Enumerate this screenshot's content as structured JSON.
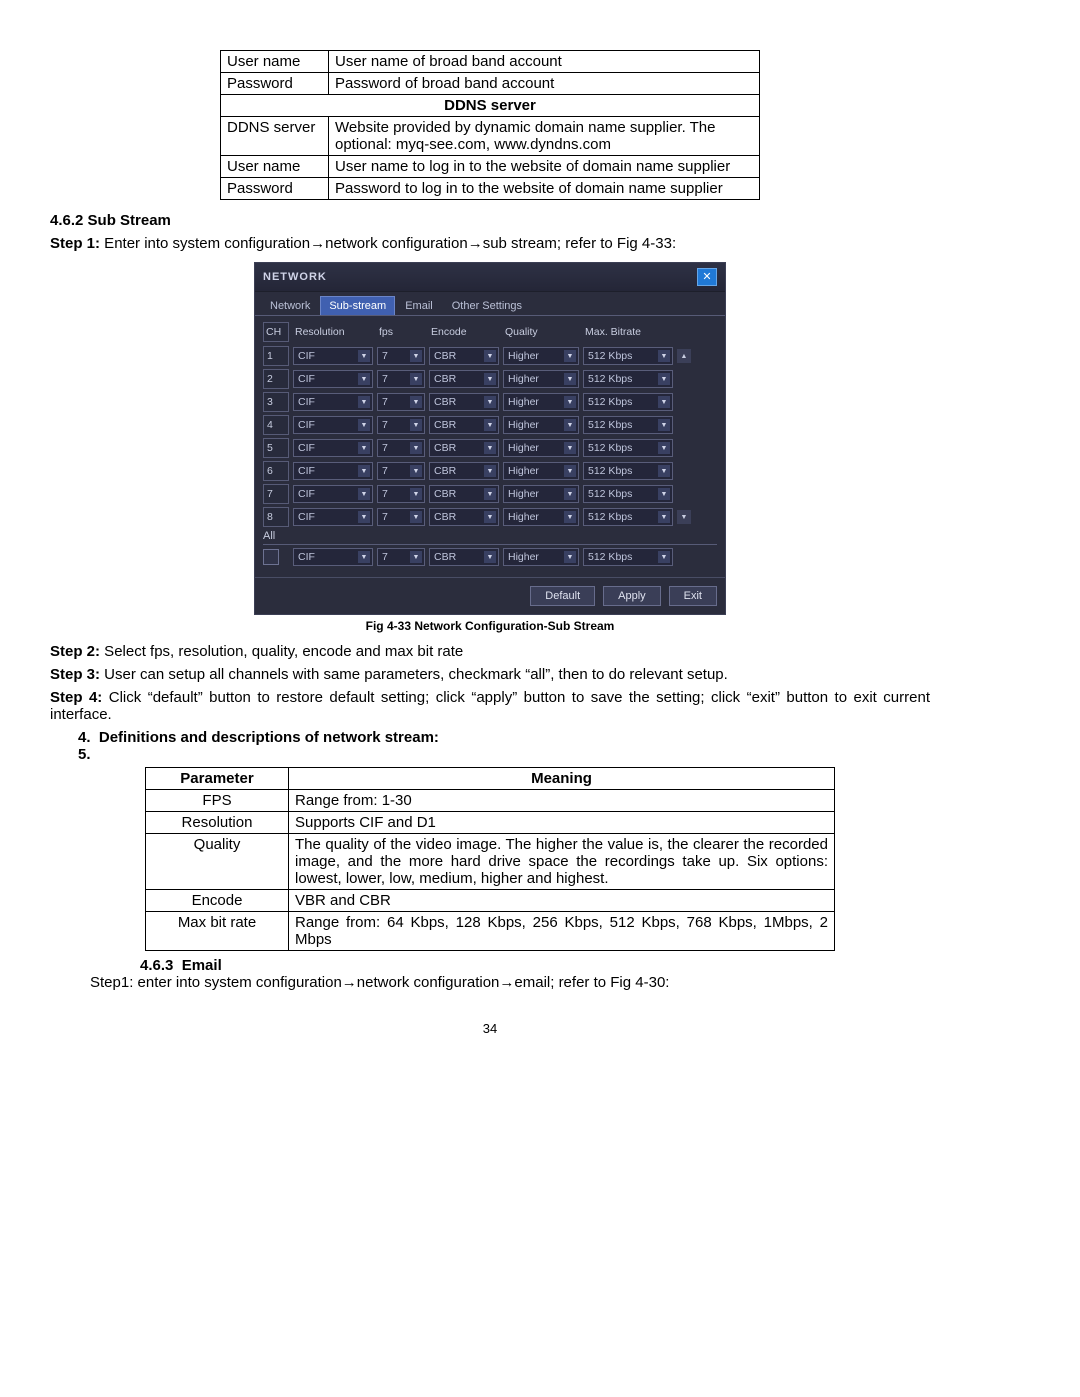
{
  "table1": {
    "r1c1": "User name",
    "r1c2": "User name of broad band account",
    "r2c1": "Password",
    "r2c2": "Password of broad band account",
    "section": "DDNS server",
    "r3c1": "DDNS server",
    "r3c2": "Website provided by dynamic domain name supplier. The optional: myq-see.com, www.dyndns.com",
    "r4c1": "User name",
    "r4c2": "User name to log in to the website of domain name supplier",
    "r5c1": "Password",
    "r5c2": "Password to log in to the website of domain name supplier"
  },
  "section_462": "4.6.2 Sub Stream",
  "step1_lead": "Step 1:",
  "step1_text": " Enter into system configuration→network configuration→sub stream; refer to Fig 4-33:",
  "ui": {
    "title": "NETWORK",
    "tabs": [
      "Network",
      "Sub-stream",
      "Email",
      "Other Settings"
    ],
    "headers": [
      "CH",
      "Resolution",
      "fps",
      "Encode",
      "Quality",
      "Max. Bitrate"
    ],
    "rows": [
      {
        "ch": "1",
        "res": "CIF",
        "fps": "7",
        "enc": "CBR",
        "q": "Higher",
        "br": "512 Kbps"
      },
      {
        "ch": "2",
        "res": "CIF",
        "fps": "7",
        "enc": "CBR",
        "q": "Higher",
        "br": "512 Kbps"
      },
      {
        "ch": "3",
        "res": "CIF",
        "fps": "7",
        "enc": "CBR",
        "q": "Higher",
        "br": "512 Kbps"
      },
      {
        "ch": "4",
        "res": "CIF",
        "fps": "7",
        "enc": "CBR",
        "q": "Higher",
        "br": "512 Kbps"
      },
      {
        "ch": "5",
        "res": "CIF",
        "fps": "7",
        "enc": "CBR",
        "q": "Higher",
        "br": "512 Kbps"
      },
      {
        "ch": "6",
        "res": "CIF",
        "fps": "7",
        "enc": "CBR",
        "q": "Higher",
        "br": "512 Kbps"
      },
      {
        "ch": "7",
        "res": "CIF",
        "fps": "7",
        "enc": "CBR",
        "q": "Higher",
        "br": "512 Kbps"
      },
      {
        "ch": "8",
        "res": "CIF",
        "fps": "7",
        "enc": "CBR",
        "q": "Higher",
        "br": "512 Kbps"
      }
    ],
    "all_label": "All",
    "all": {
      "res": "CIF",
      "fps": "7",
      "enc": "CBR",
      "q": "Higher",
      "br": "512 Kbps"
    },
    "buttons": {
      "default": "Default",
      "apply": "Apply",
      "exit": "Exit"
    }
  },
  "caption": "Fig 4-33 Network Configuration-Sub Stream",
  "step2_lead": "Step 2:",
  "step2_text": " Select fps, resolution, quality, encode and max bit rate",
  "step3_lead": "Step 3:",
  "step3_text": " User can setup all channels with same parameters, checkmark “all”, then to do relevant setup.",
  "step4_lead": "Step 4:",
  "step4_text": " Click “default” button to restore default setting; click “apply” button to save the setting; click “exit” button to exit current interface.",
  "bullet4": "4.",
  "bullet4_text": "Definitions and descriptions of network stream:",
  "bullet5": "5.",
  "params": {
    "h1": "Parameter",
    "h2": "Meaning",
    "rows": [
      {
        "p": "FPS",
        "m": "Range from: 1-30"
      },
      {
        "p": "Resolution",
        "m": "Supports CIF and D1"
      },
      {
        "p": "Quality",
        "m": "The quality of the video image. The higher the value is, the clearer the recorded image, and the more hard drive space the recordings take up. Six options: lowest, lower, low, medium, higher and highest."
      },
      {
        "p": "Encode",
        "m": "VBR and CBR"
      },
      {
        "p": "Max bit rate",
        "m": "Range from: 64 Kbps, 128 Kbps, 256 Kbps, 512 Kbps, 768 Kbps, 1Mbps, 2 Mbps"
      }
    ]
  },
  "section_463_num": "4.6.3",
  "section_463_title": "Email",
  "email_step": "Step1: enter into system configuration→network configuration→email; refer to Fig 4-30:",
  "page_number": "34"
}
